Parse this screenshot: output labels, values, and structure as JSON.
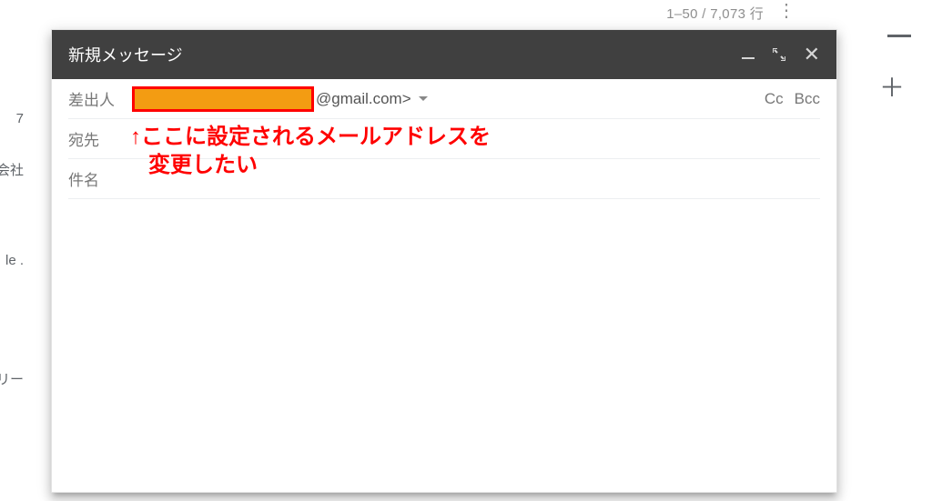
{
  "background": {
    "pagination": "1–50 / 7,073 行",
    "sidebar": {
      "item1": "7",
      "item2": "会社",
      "item3": "le .",
      "item4": "リー"
    }
  },
  "compose": {
    "title": "新規メッセージ",
    "fields": {
      "from_label": "差出人",
      "from_email_suffix": "@gmail.com>",
      "to_label": "宛先",
      "subject_label": "件名",
      "cc": "Cc",
      "bcc": "Bcc"
    }
  },
  "annotation": {
    "line1": "↑ここに設定されるメールアドレスを",
    "line2": "変更したい"
  }
}
